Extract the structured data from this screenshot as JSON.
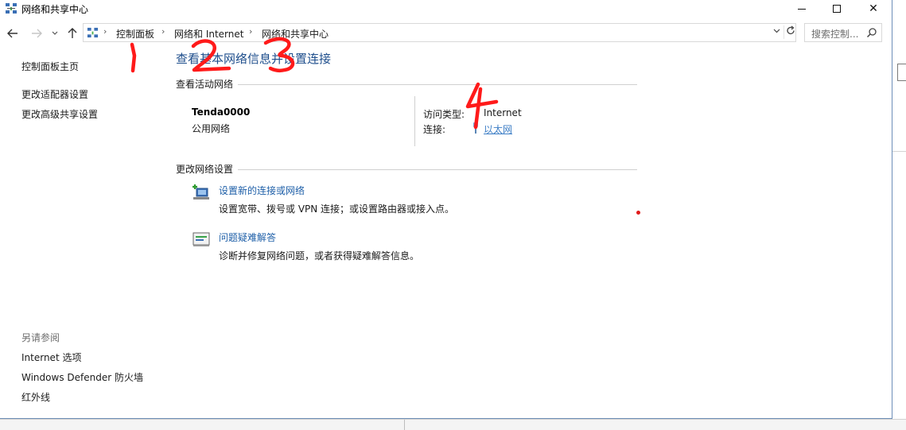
{
  "window": {
    "title": "网络和共享中心",
    "controls": {
      "minimize": "minimize",
      "maximize": "maximize",
      "close": "✕"
    }
  },
  "nav": {
    "back_icon": "arrow-left-icon",
    "forward_icon": "arrow-right-icon",
    "recent_icon": "chevron-down-icon",
    "up_icon": "arrow-up-icon",
    "breadcrumbs": [
      "控制面板",
      "网络和 Internet",
      "网络和共享中心"
    ],
    "search_placeholder": "搜索控制..."
  },
  "sidebar": {
    "links": [
      "控制面板主页",
      "更改适配器设置",
      "更改高级共享设置"
    ],
    "see_also_title": "另请参阅",
    "see_also": [
      "Internet 选项",
      "Windows Defender 防火墙",
      "红外线"
    ]
  },
  "main": {
    "title": "查看基本网络信息并设置连接",
    "active_networks_header": "查看活动网络",
    "network": {
      "name": "Tenda0000",
      "type": "公用网络",
      "access_type_label": "访问类型:",
      "access_type_value": "Internet",
      "connection_label": "连接:",
      "connection_value": "以太网"
    },
    "change_settings_header": "更改网络设置",
    "tasks": [
      {
        "icon": "new-connection-icon",
        "title": "设置新的连接或网络",
        "desc": "设置宽带、拨号或 VPN 连接；或设置路由器或接入点。"
      },
      {
        "icon": "troubleshoot-icon",
        "title": "问题疑难解答",
        "desc": "诊断并修复网络问题，或者获得疑难解答信息。"
      }
    ]
  },
  "annotations": {
    "marks": [
      "1",
      "2",
      "3",
      "4"
    ],
    "color": "#ff1a1a"
  }
}
